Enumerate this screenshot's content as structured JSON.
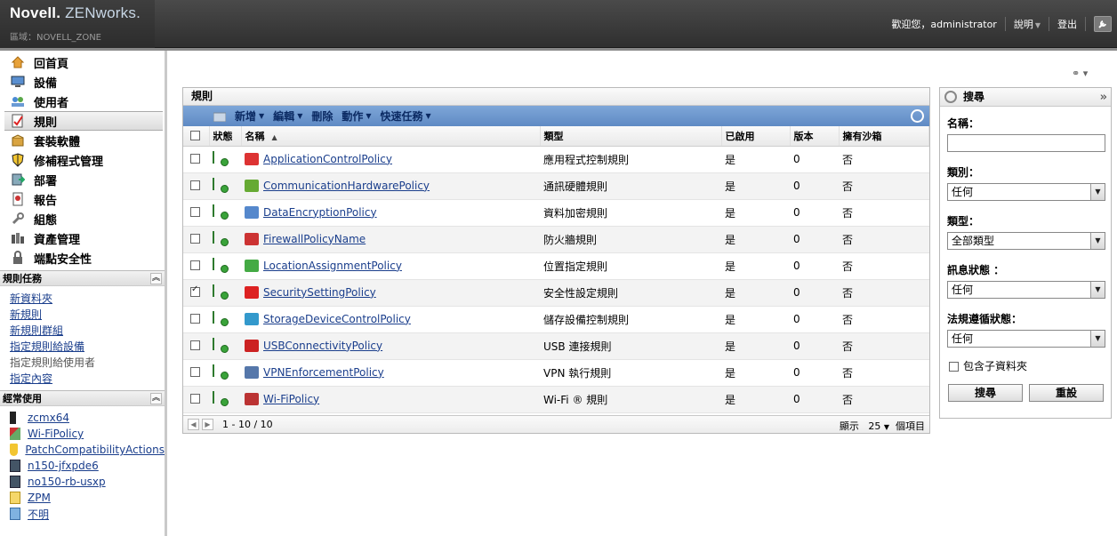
{
  "header": {
    "brand_novell": "Novell.",
    "brand_zen": "ZENworks.",
    "zone": "區域：NOVELL_ZONE",
    "welcome": "歡迎您，administrator",
    "help": "說明",
    "logout": "登出"
  },
  "nav": {
    "items": [
      {
        "label": "回首頁",
        "icon": "home-icon"
      },
      {
        "label": "設備",
        "icon": "monitor-icon"
      },
      {
        "label": "使用者",
        "icon": "users-icon"
      },
      {
        "label": "規則",
        "icon": "policy-icon"
      },
      {
        "label": "套裝軟體",
        "icon": "bundle-icon"
      },
      {
        "label": "修補程式管理",
        "icon": "shield-icon"
      },
      {
        "label": "部署",
        "icon": "deploy-icon"
      },
      {
        "label": "報告",
        "icon": "report-icon"
      },
      {
        "label": "組態",
        "icon": "wrench-icon"
      },
      {
        "label": "資產管理",
        "icon": "asset-icon"
      },
      {
        "label": "端點安全性",
        "icon": "lock-icon"
      }
    ]
  },
  "tasks": {
    "title": "規則任務",
    "items": [
      "新資料夾",
      "新規則",
      "新規則群組",
      "指定規則給設備",
      "指定規則給使用者",
      "指定內容"
    ]
  },
  "recent": {
    "title": "經常使用",
    "items": [
      "zcmx64",
      "Wi-FiPolicy",
      "PatchCompatibilityActions",
      "n150-jfxpde6",
      "no150-rb-usxp",
      "ZPM",
      "不明"
    ]
  },
  "panel": {
    "title": "規則",
    "toolbar": {
      "new": "新增",
      "edit": "編輯",
      "delete": "刪除",
      "action": "動作",
      "quick": "快速任務"
    },
    "columns": {
      "status": "狀態",
      "name": "名稱",
      "type": "類型",
      "enabled": "已啟用",
      "version": "版本",
      "sandbox": "擁有沙箱"
    },
    "rows": [
      {
        "name": "ApplicationControlPolicy",
        "type": "應用程式控制規則",
        "enabled": "是",
        "version": "0",
        "sandbox": "否",
        "checked": false,
        "color": "#d33"
      },
      {
        "name": "CommunicationHardwarePolicy",
        "type": "通訊硬體規則",
        "enabled": "是",
        "version": "0",
        "sandbox": "否",
        "checked": false,
        "color": "#6a3"
      },
      {
        "name": "DataEncryptionPolicy",
        "type": "資料加密規則",
        "enabled": "是",
        "version": "0",
        "sandbox": "否",
        "checked": false,
        "color": "#58c"
      },
      {
        "name": "FirewallPolicyName",
        "type": "防火牆規則",
        "enabled": "是",
        "version": "0",
        "sandbox": "否",
        "checked": false,
        "color": "#c33"
      },
      {
        "name": "LocationAssignmentPolicy",
        "type": "位置指定規則",
        "enabled": "是",
        "version": "0",
        "sandbox": "否",
        "checked": false,
        "color": "#4a4"
      },
      {
        "name": "SecuritySettingPolicy",
        "type": "安全性設定規則",
        "enabled": "是",
        "version": "0",
        "sandbox": "否",
        "checked": true,
        "color": "#d22"
      },
      {
        "name": "StorageDeviceControlPolicy",
        "type": "儲存設備控制規則",
        "enabled": "是",
        "version": "0",
        "sandbox": "否",
        "checked": false,
        "color": "#39c"
      },
      {
        "name": "USBConnectivityPolicy",
        "type": "USB 連接規則",
        "enabled": "是",
        "version": "0",
        "sandbox": "否",
        "checked": false,
        "color": "#c22"
      },
      {
        "name": "VPNEnforcementPolicy",
        "type": "VPN 執行規則",
        "enabled": "是",
        "version": "0",
        "sandbox": "否",
        "checked": false,
        "color": "#57a"
      },
      {
        "name": "Wi-FiPolicy",
        "type": "Wi-Fi ® 規則",
        "enabled": "是",
        "version": "0",
        "sandbox": "否",
        "checked": false,
        "color": "#b33"
      }
    ],
    "pager": {
      "range": "1 - 10 / 10",
      "show": "顯示",
      "per_page": "25",
      "items": "個項目"
    }
  },
  "search": {
    "title": "搜尋",
    "name_label": "名稱：",
    "name_value": "",
    "category_label": "類別：",
    "category_value": "任何",
    "type_label": "類型：",
    "type_value": "全部類型",
    "message_label": "訊息狀態 ：",
    "message_value": "任何",
    "compliance_label": "法規遵循狀態：",
    "compliance_value": "任何",
    "subfolder_label": "包含子資料夾",
    "search_button": "搜尋",
    "reset_button": "重設"
  }
}
